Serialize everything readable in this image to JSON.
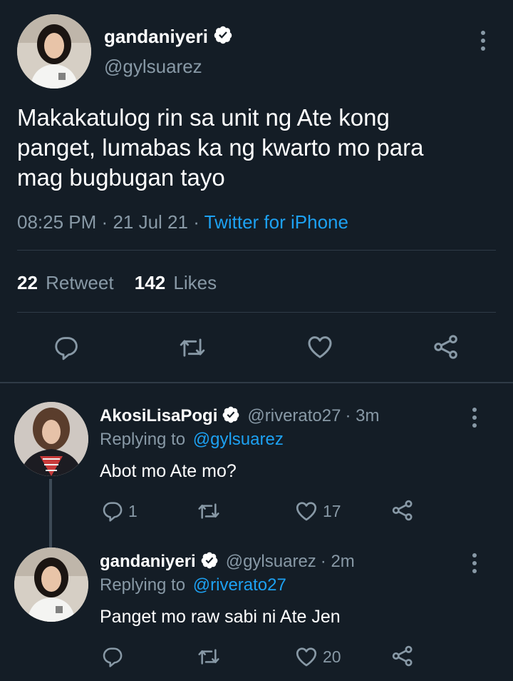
{
  "main_tweet": {
    "display_name": "gandaniyeri",
    "handle": "@gylsuarez",
    "text_lines": [
      "Makakatulog rin sa unit ng Ate kong",
      "panget, lumabas ka ng kwarto mo para",
      "mag bugbugan tayo"
    ],
    "time": "08:25 PM",
    "sep1": "·",
    "date": "21 Jul 21",
    "sep2": "·",
    "source": "Twitter for iPhone",
    "retweet_count": "22",
    "retweet_label": "Retweet",
    "likes_count": "142",
    "likes_label": "Likes"
  },
  "replies": [
    {
      "display_name": "AkosiLisaPogi",
      "handle": "@riverato27",
      "time": "· 3m",
      "replying_prefix": "Replying to",
      "replying_to": "@gylsuarez",
      "text": "Abot mo Ate mo?",
      "reply_count": "1",
      "retweet_count": "",
      "like_count": "17"
    },
    {
      "display_name": "gandaniyeri",
      "handle": "@gylsuarez",
      "time": "· 2m",
      "replying_prefix": "Replying to",
      "replying_to": "@riverato27",
      "text": "Panget mo raw sabi ni Ate Jen",
      "reply_count": "",
      "retweet_count": "",
      "like_count": "20"
    }
  ],
  "colors": {
    "background": "#141d26",
    "text": "#ffffff",
    "muted": "#8899a6",
    "link": "#1da1f2",
    "divider": "#2f3b47"
  },
  "icons": [
    "verified-badge-icon",
    "more-options-icon",
    "reply-icon",
    "retweet-icon",
    "like-icon",
    "share-icon"
  ]
}
